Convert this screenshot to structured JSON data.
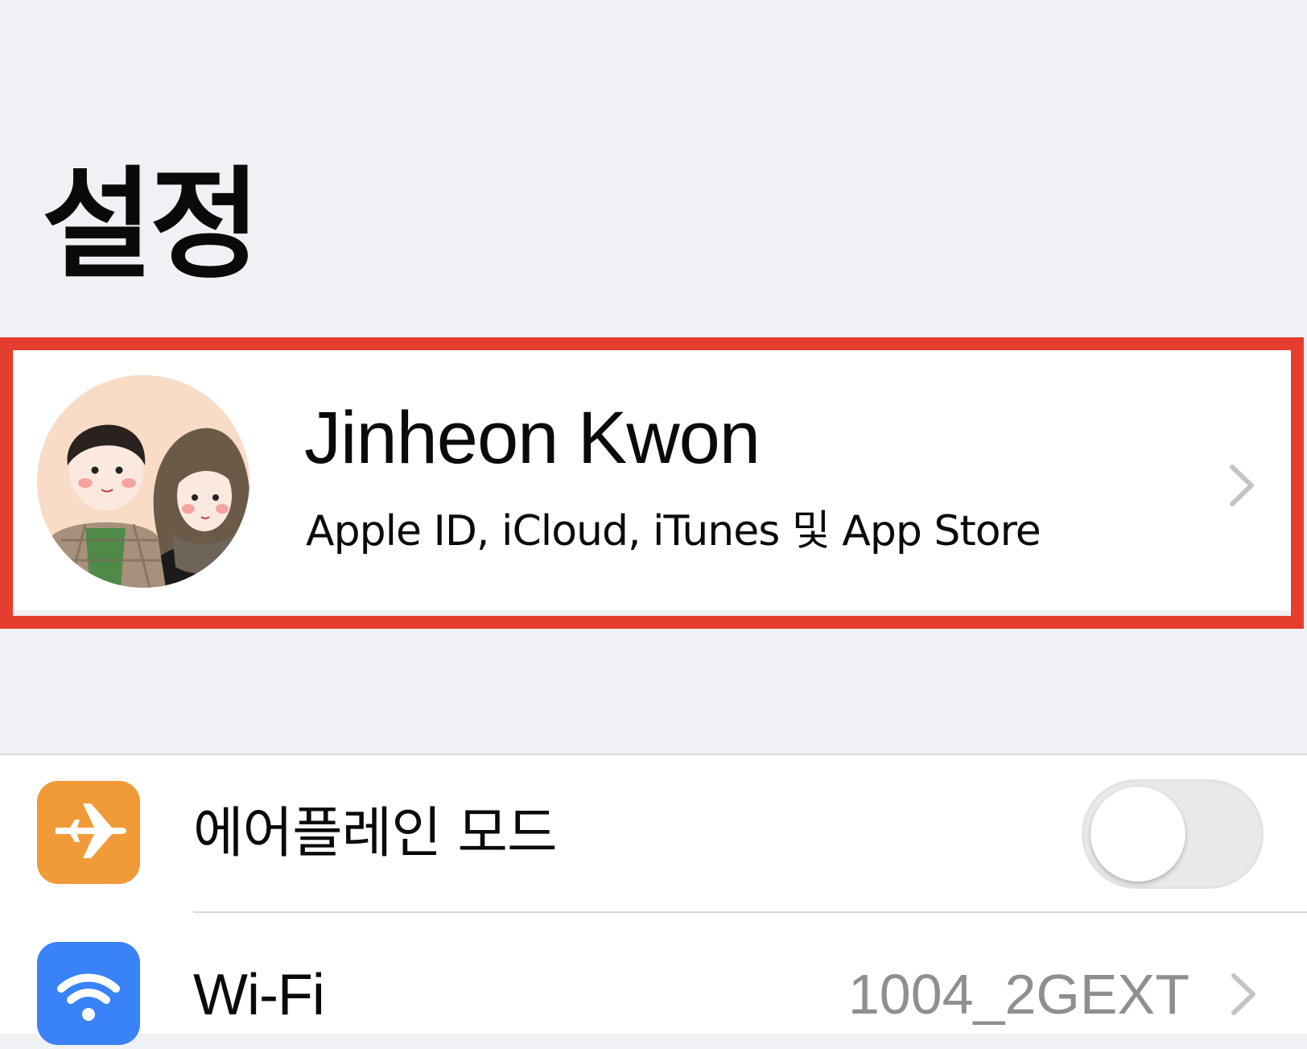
{
  "header": {
    "title": "설정"
  },
  "profile": {
    "name": "Jinheon Kwon",
    "subtitle": "Apple ID, iCloud, iTunes 및 App Store",
    "highlight_color": "#e53d2e"
  },
  "settings": {
    "rows": [
      {
        "label": "에어플레인 모드",
        "icon": "airplane-icon",
        "icon_color": "#f19a38",
        "control": "toggle",
        "toggle_on": false
      },
      {
        "label": "Wi-Fi",
        "icon": "wifi-icon",
        "icon_color": "#3a82f7",
        "value": "1004_2GEXT",
        "control": "chevron"
      }
    ]
  }
}
